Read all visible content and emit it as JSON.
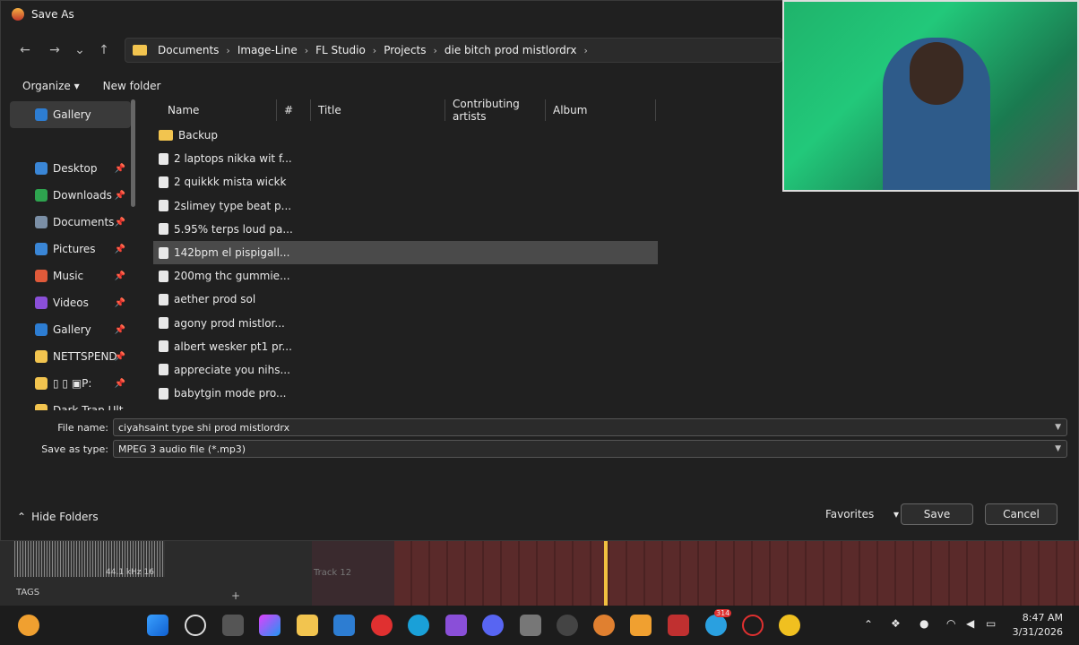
{
  "window": {
    "title": "Save As"
  },
  "nav": {
    "back": "←",
    "forward": "→",
    "down": "⌄",
    "up": "↑"
  },
  "breadcrumb": [
    "Documents",
    "Image-Line",
    "FL Studio",
    "Projects",
    "die bitch prod mistlordrx"
  ],
  "toolbar": {
    "organize": "Organize",
    "organize_arrow": "▾",
    "new_folder": "New folder"
  },
  "sidebar": {
    "items": [
      {
        "label": "Gallery",
        "icon": "gallery-icon",
        "color": "#2d7dd2",
        "pinned": false,
        "selected": true
      },
      {
        "label": "Desktop",
        "icon": "desktop-icon",
        "color": "#3a86d6",
        "pinned": true
      },
      {
        "label": "Downloads",
        "icon": "download-icon",
        "color": "#2ea44f",
        "pinned": true
      },
      {
        "label": "Documents",
        "icon": "documents-icon",
        "color": "#7b8fa6",
        "pinned": true
      },
      {
        "label": "Pictures",
        "icon": "pictures-icon",
        "color": "#3a86d6",
        "pinned": true
      },
      {
        "label": "Music",
        "icon": "music-icon",
        "color": "#e05a3a",
        "pinned": true
      },
      {
        "label": "Videos",
        "icon": "videos-icon",
        "color": "#8a4fd8",
        "pinned": true
      },
      {
        "label": "Gallery",
        "icon": "gallery-icon",
        "color": "#2d7dd2",
        "pinned": true
      },
      {
        "label": "NETTSPEND",
        "icon": "folder-icon",
        "color": "#f2c44f",
        "pinned": true
      },
      {
        "label": "▯ ▯ ▣P:",
        "icon": "folder-icon",
        "color": "#f2c44f",
        "pinned": true
      },
      {
        "label": "Dark Trap Ult",
        "icon": "folder-icon",
        "color": "#f2c44f",
        "pinned": false
      }
    ]
  },
  "columns": [
    "Name",
    "#",
    "Title",
    "Contributing artists",
    "Album"
  ],
  "files": [
    {
      "name": "Backup",
      "type": "folder"
    },
    {
      "name": "2 laptops nikka wit f...",
      "type": "file"
    },
    {
      "name": "2 quikkk mista wickk",
      "type": "file"
    },
    {
      "name": "2slimey type beat p...",
      "type": "file"
    },
    {
      "name": "5.95% terps loud pa...",
      "type": "file"
    },
    {
      "name": "142bpm el pispigall...",
      "type": "file",
      "highlighted": true
    },
    {
      "name": "200mg thc gummie...",
      "type": "file"
    },
    {
      "name": "aether prod sol",
      "type": "file"
    },
    {
      "name": "agony prod mistlor...",
      "type": "file"
    },
    {
      "name": "albert wesker pt1 pr...",
      "type": "file"
    },
    {
      "name": "appreciate you nihs...",
      "type": "file"
    },
    {
      "name": "babytgin mode pro...",
      "type": "file"
    }
  ],
  "form": {
    "file_name_label": "File name:",
    "file_name_value": "ciyahsaint type shi prod mistlordrx",
    "save_type_label": "Save as type:",
    "save_type_value": "MPEG 3 audio file (*.mp3)"
  },
  "buttons": {
    "hide_folders": "Hide Folders",
    "favorites": "Favorites",
    "favorites_arrow": "▾",
    "save": "Save",
    "cancel": "Cancel"
  },
  "daw": {
    "sample_info": "44.1 kHz 16",
    "tags": "TAGS",
    "track": "Track 12",
    "add": "+"
  },
  "taskbar": {
    "time": "8:47 AM",
    "date": "3/31/2026",
    "badge": "314"
  }
}
